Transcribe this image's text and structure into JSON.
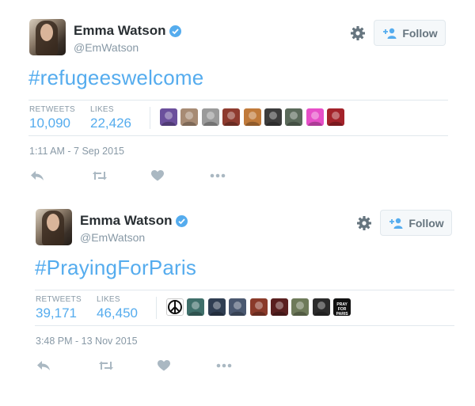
{
  "colors": {
    "link": "#55acee",
    "muted": "#8899a6",
    "text": "#292f33",
    "border": "#e1e8ed",
    "icon": "#aab8c2"
  },
  "tweets": [
    {
      "author": {
        "name": "Emma Watson",
        "handle": "@EmWatson",
        "verified": true
      },
      "follow_label": "Follow",
      "text": "#refugeeswelcome",
      "stats": {
        "retweets_label": "RETWEETS",
        "retweets": "10,090",
        "likes_label": "LIKES",
        "likes": "22,426"
      },
      "likers": [
        {
          "icon": "liker-avatar",
          "color": "#6b4f9c"
        },
        {
          "icon": "liker-avatar",
          "color": "#a78b74"
        },
        {
          "icon": "liker-avatar",
          "color": "#9a9a9a"
        },
        {
          "icon": "liker-avatar",
          "color": "#8e3b2f"
        },
        {
          "icon": "liker-avatar",
          "color": "#c07a3a"
        },
        {
          "icon": "liker-avatar",
          "color": "#3c3c3c"
        },
        {
          "icon": "liker-avatar",
          "color": "#5b6a5b"
        },
        {
          "icon": "liker-avatar",
          "color": "#e64fc8"
        },
        {
          "icon": "liker-avatar",
          "color": "#a3222a"
        }
      ],
      "timestamp": "1:11 AM - 7 Sep 2015",
      "actions": [
        "reply-icon",
        "retweet-icon",
        "like-icon",
        "more-icon"
      ]
    },
    {
      "author": {
        "name": "Emma Watson",
        "handle": "@EmWatson",
        "verified": true
      },
      "follow_label": "Follow",
      "text": "#PrayingForParis",
      "stats": {
        "retweets_label": "RETWEETS",
        "retweets": "39,171",
        "likes_label": "LIKES",
        "likes": "46,450"
      },
      "likers": [
        {
          "icon": "peace-for-paris-avatar",
          "color": "#ffffff"
        },
        {
          "icon": "liker-avatar",
          "color": "#3f6f6a"
        },
        {
          "icon": "liker-avatar",
          "color": "#2f3e52"
        },
        {
          "icon": "liker-avatar",
          "color": "#4a5870"
        },
        {
          "icon": "liker-avatar",
          "color": "#8a3a2a"
        },
        {
          "icon": "liker-avatar",
          "color": "#5a2020"
        },
        {
          "icon": "liker-avatar",
          "color": "#6e7a5a"
        },
        {
          "icon": "liker-avatar",
          "color": "#2b2b2b"
        },
        {
          "icon": "pray-for-paris-avatar",
          "color": "#111111",
          "text": "PRAY FOR PARIS"
        }
      ],
      "timestamp": "3:48 PM - 13 Nov 2015",
      "actions": [
        "reply-icon",
        "retweet-icon",
        "like-icon",
        "more-icon"
      ]
    }
  ]
}
